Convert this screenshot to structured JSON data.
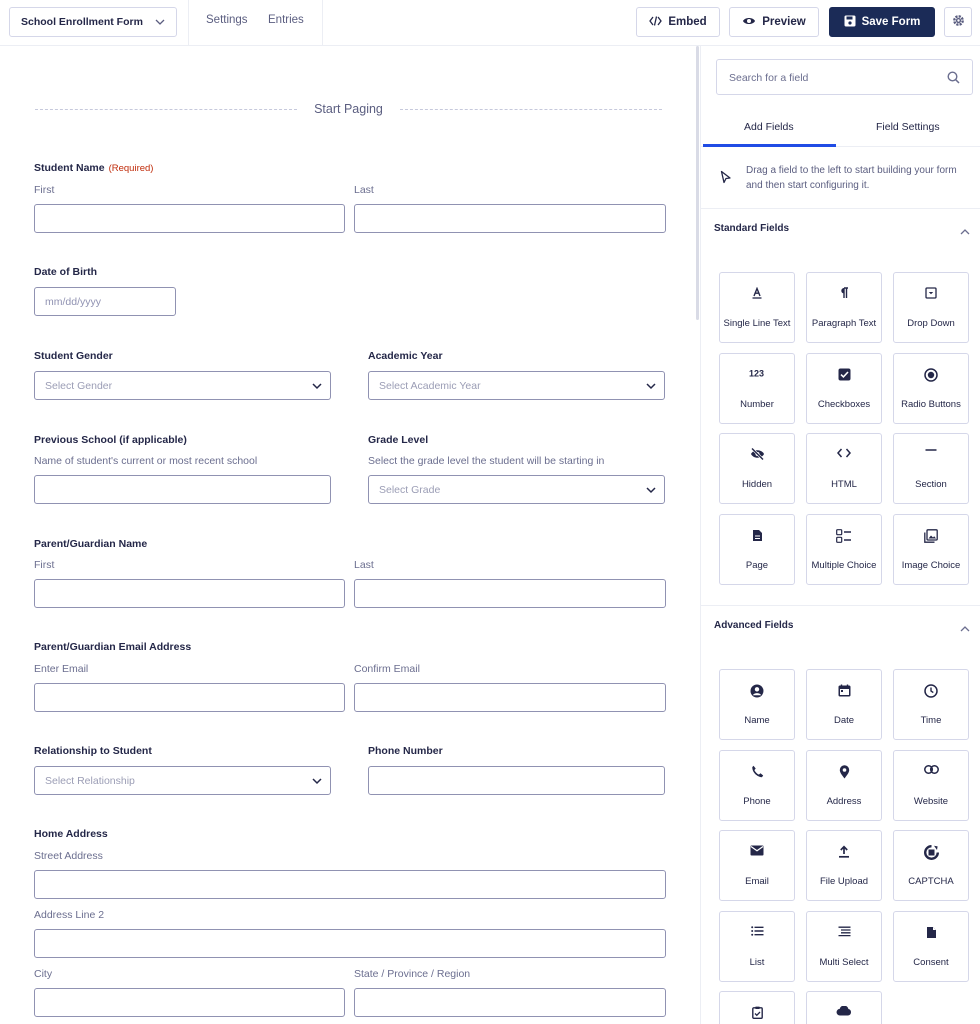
{
  "toolbar": {
    "form_name": "School Enrollment Form",
    "nav": [
      "Settings",
      "Entries"
    ],
    "embed_label": "Embed",
    "preview_label": "Preview",
    "save_label": "Save Form"
  },
  "form": {
    "paging_label": "Start Paging",
    "student_name": {
      "label": "Student Name",
      "required": "(Required)",
      "first": "First",
      "last": "Last"
    },
    "dob": {
      "label": "Date of Birth",
      "placeholder": "mm/dd/yyyy"
    },
    "gender": {
      "label": "Student Gender",
      "placeholder": "Select Gender"
    },
    "academic_year": {
      "label": "Academic Year",
      "placeholder": "Select Academic Year"
    },
    "previous_school": {
      "label": "Previous School (if applicable)",
      "description": "Name of student's current or most recent school"
    },
    "grade_level": {
      "label": "Grade Level",
      "description": "Select the grade level the student will be starting in",
      "placeholder": "Select Grade"
    },
    "guardian_name": {
      "label": "Parent/Guardian Name",
      "first": "First",
      "last": "Last"
    },
    "guardian_email": {
      "label": "Parent/Guardian Email Address",
      "enter": "Enter Email",
      "confirm": "Confirm Email"
    },
    "relationship": {
      "label": "Relationship to Student",
      "placeholder": "Select Relationship"
    },
    "phone": {
      "label": "Phone Number"
    },
    "address": {
      "label": "Home Address",
      "street": "Street Address",
      "line2": "Address Line 2",
      "city": "City",
      "state": "State / Province / Region"
    }
  },
  "sidebar": {
    "search_placeholder": "Search for a field",
    "tabs": [
      "Add Fields",
      "Field Settings"
    ],
    "hint": "Drag a field to the left to start building your form and then start configuring it.",
    "standard_title": "Standard Fields",
    "standard_fields": [
      {
        "label": "Single Line Text",
        "icon": "single-line-text-icon"
      },
      {
        "label": "Paragraph Text",
        "icon": "paragraph-icon"
      },
      {
        "label": "Drop Down",
        "icon": "dropdown-icon"
      },
      {
        "label": "Number",
        "icon": "number-icon"
      },
      {
        "label": "Checkboxes",
        "icon": "checkbox-icon"
      },
      {
        "label": "Radio Buttons",
        "icon": "radio-icon"
      },
      {
        "label": "Hidden",
        "icon": "eye-slash-icon"
      },
      {
        "label": "HTML",
        "icon": "code-icon"
      },
      {
        "label": "Section",
        "icon": "minus-icon"
      },
      {
        "label": "Page",
        "icon": "page-icon"
      },
      {
        "label": "Multiple Choice",
        "icon": "multiple-choice-icon"
      },
      {
        "label": "Image Choice",
        "icon": "image-choice-icon"
      }
    ],
    "advanced_title": "Advanced Fields",
    "advanced_fields": [
      {
        "label": "Name",
        "icon": "user-icon"
      },
      {
        "label": "Date",
        "icon": "calendar-icon"
      },
      {
        "label": "Time",
        "icon": "clock-icon"
      },
      {
        "label": "Phone",
        "icon": "phone-icon"
      },
      {
        "label": "Address",
        "icon": "map-pin-icon"
      },
      {
        "label": "Website",
        "icon": "link-icon"
      },
      {
        "label": "Email",
        "icon": "envelope-icon"
      },
      {
        "label": "File Upload",
        "icon": "upload-icon"
      },
      {
        "label": "CAPTCHA",
        "icon": "captcha-icon"
      },
      {
        "label": "List",
        "icon": "list-icon"
      },
      {
        "label": "Multi Select",
        "icon": "multi-select-icon"
      },
      {
        "label": "Consent",
        "icon": "document-icon"
      },
      {
        "label": "",
        "icon": "clipboard-icon"
      },
      {
        "label": "",
        "icon": "cloud-icon"
      }
    ]
  }
}
